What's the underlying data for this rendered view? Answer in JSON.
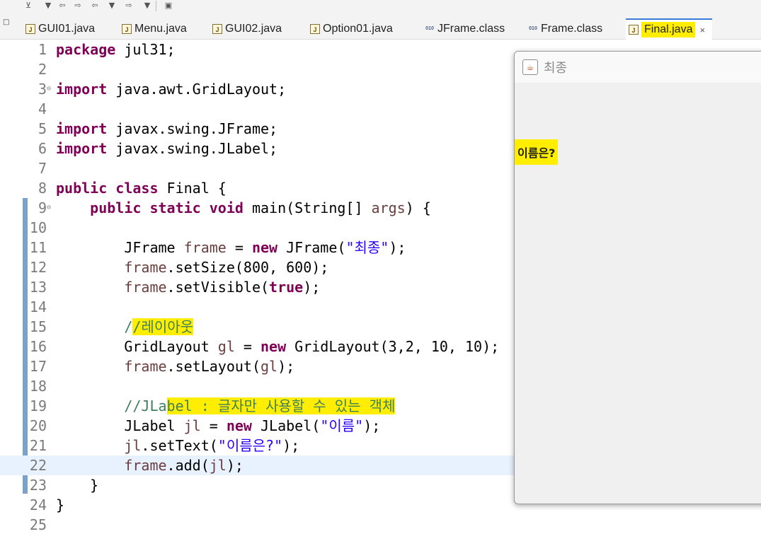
{
  "toolbar": {
    "buttons": [
      {
        "icon": "pin-icon",
        "glyph": "⊻"
      },
      {
        "icon": "dropdown-arrow-icon",
        "glyph": "▼"
      },
      {
        "icon": "prev-edit-icon",
        "glyph": "⇦"
      },
      {
        "icon": "next-annotation-icon",
        "glyph": "⇨"
      },
      {
        "icon": "back-icon",
        "glyph": "⇦"
      },
      {
        "icon": "dropdown-arrow-icon",
        "glyph": "▼"
      },
      {
        "icon": "forward-icon",
        "glyph": "⇨"
      },
      {
        "icon": "dropdown-arrow-icon",
        "glyph": "▼"
      },
      {
        "icon": "open-task-icon",
        "glyph": "▣"
      }
    ]
  },
  "tabs": [
    {
      "label": "GUI01.java",
      "kind": "java"
    },
    {
      "label": "Menu.java",
      "kind": "java"
    },
    {
      "label": "GUI02.java",
      "kind": "java"
    },
    {
      "label": "Option01.java",
      "kind": "java"
    },
    {
      "label": "JFrame.class",
      "kind": "class"
    },
    {
      "label": "Frame.class",
      "kind": "class"
    },
    {
      "label": "Final.java",
      "kind": "java",
      "active": true
    }
  ],
  "tab_close_glyph": "×",
  "editor": {
    "lines": [
      {
        "n": "1",
        "code": [
          {
            "t": "package ",
            "c": "kw"
          },
          {
            "t": "jul31;"
          }
        ]
      },
      {
        "n": "2",
        "code": []
      },
      {
        "n": "3",
        "fold": true,
        "code": [
          {
            "t": "import ",
            "c": "kw"
          },
          {
            "t": "java.awt.GridLayout;"
          }
        ]
      },
      {
        "n": "4",
        "code": []
      },
      {
        "n": "5",
        "code": [
          {
            "t": "import ",
            "c": "kw"
          },
          {
            "t": "javax.swing.JFrame;"
          }
        ]
      },
      {
        "n": "6",
        "code": [
          {
            "t": "import ",
            "c": "kw"
          },
          {
            "t": "javax.swing.JLabel;"
          }
        ]
      },
      {
        "n": "7",
        "code": []
      },
      {
        "n": "8",
        "code": [
          {
            "t": "public class ",
            "c": "kw"
          },
          {
            "t": "Final {"
          }
        ]
      },
      {
        "n": "9",
        "fold": true,
        "code": [
          {
            "t": "    "
          },
          {
            "t": "public static void ",
            "c": "kw"
          },
          {
            "t": "main(String[] "
          },
          {
            "t": "args",
            "c": "var"
          },
          {
            "t": ") {"
          }
        ]
      },
      {
        "n": "10",
        "code": []
      },
      {
        "n": "11",
        "code": [
          {
            "t": "        JFrame "
          },
          {
            "t": "frame",
            "c": "var"
          },
          {
            "t": " = "
          },
          {
            "t": "new ",
            "c": "kw"
          },
          {
            "t": "JFrame("
          },
          {
            "t": "\"최종\"",
            "c": "str"
          },
          {
            "t": ");"
          }
        ]
      },
      {
        "n": "12",
        "code": [
          {
            "t": "        "
          },
          {
            "t": "frame",
            "c": "var"
          },
          {
            "t": ".setSize(800, 600);"
          }
        ]
      },
      {
        "n": "13",
        "code": [
          {
            "t": "        "
          },
          {
            "t": "frame",
            "c": "var"
          },
          {
            "t": ".setVisible("
          },
          {
            "t": "true",
            "c": "kw"
          },
          {
            "t": ");"
          }
        ]
      },
      {
        "n": "14",
        "code": []
      },
      {
        "n": "15",
        "code": [
          {
            "t": "        "
          },
          {
            "t": "/",
            "c": "cm"
          },
          {
            "t": "/레이아웃",
            "c": "cm",
            "hl": true
          }
        ]
      },
      {
        "n": "16",
        "code": [
          {
            "t": "        GridLayout "
          },
          {
            "t": "gl",
            "c": "var"
          },
          {
            "t": " = "
          },
          {
            "t": "new ",
            "c": "kw"
          },
          {
            "t": "GridLayout(3,2, 10, 10);"
          }
        ]
      },
      {
        "n": "17",
        "code": [
          {
            "t": "        "
          },
          {
            "t": "frame",
            "c": "var"
          },
          {
            "t": ".setLayout("
          },
          {
            "t": "gl",
            "c": "var"
          },
          {
            "t": ");"
          }
        ]
      },
      {
        "n": "18",
        "code": []
      },
      {
        "n": "19",
        "code": [
          {
            "t": "        "
          },
          {
            "t": "//JLa",
            "c": "cm"
          },
          {
            "t": "bel : 글자만 사용할 수 있는 객체",
            "c": "cm",
            "hl": true
          }
        ]
      },
      {
        "n": "20",
        "code": [
          {
            "t": "        JLabel "
          },
          {
            "t": "jl",
            "c": "var"
          },
          {
            "t": " = "
          },
          {
            "t": "new ",
            "c": "kw"
          },
          {
            "t": "JLabel("
          },
          {
            "t": "\"이름\"",
            "c": "str"
          },
          {
            "t": ");"
          }
        ]
      },
      {
        "n": "21",
        "code": [
          {
            "t": "        "
          },
          {
            "t": "jl",
            "c": "var"
          },
          {
            "t": ".setText("
          },
          {
            "t": "\"이름은?\"",
            "c": "str"
          },
          {
            "t": ");"
          }
        ]
      },
      {
        "n": "22",
        "current": true,
        "code": [
          {
            "t": "        "
          },
          {
            "t": "frame",
            "c": "var"
          },
          {
            "t": ".add("
          },
          {
            "t": "jl",
            "c": "var"
          },
          {
            "t": ");"
          }
        ]
      },
      {
        "n": "23",
        "code": [
          {
            "t": "    }"
          }
        ]
      },
      {
        "n": "24",
        "code": [
          {
            "t": "}"
          }
        ]
      },
      {
        "n": "25",
        "code": []
      }
    ]
  },
  "swing_window": {
    "title": "최종",
    "label": "이름은?"
  }
}
